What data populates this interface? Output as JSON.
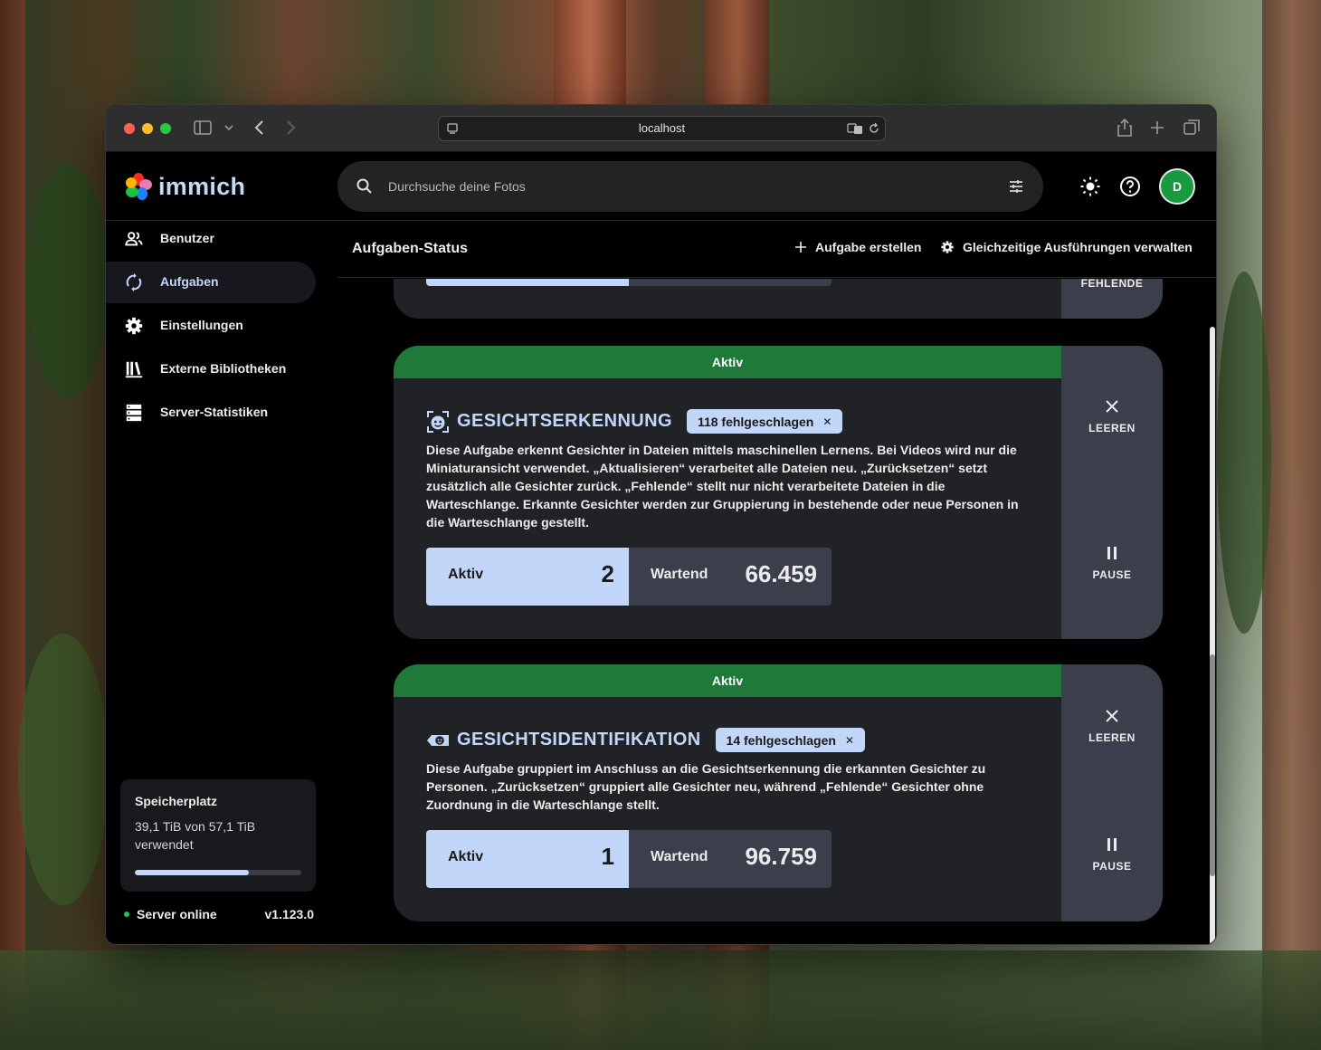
{
  "browser": {
    "url": "localhost"
  },
  "app": {
    "logo_text": "immich",
    "search_placeholder": "Durchsuche deine Fotos",
    "avatar_initial": "D"
  },
  "sidebar": {
    "items": [
      {
        "label": "Benutzer",
        "icon": "users-icon",
        "active": false
      },
      {
        "label": "Aufgaben",
        "icon": "sync-icon",
        "active": true
      },
      {
        "label": "Einstellungen",
        "icon": "gear-icon",
        "active": false
      },
      {
        "label": "Externe Bibliotheken",
        "icon": "library-icon",
        "active": false
      },
      {
        "label": "Server-Statistiken",
        "icon": "server-icon",
        "active": false
      }
    ],
    "storage": {
      "title": "Speicherplatz",
      "usage_text": "39,1 TiB von 57,1 TiB verwendet",
      "used_fraction": 0.685
    },
    "server_status": "Server online",
    "version": "v1.123.0"
  },
  "header": {
    "title": "Aufgaben-Status",
    "create_job": "Aufgabe erstellen",
    "manage_concurrency": "Gleichzeitige Ausführungen verwalten"
  },
  "previous_card": {
    "side_label": "FEHLENDE"
  },
  "jobs": [
    {
      "status": "Aktiv",
      "title": "GESICHTSERKENNUNG",
      "failed_badge": "118 fehlgeschlagen",
      "description": "Diese Aufgabe erkennt Gesichter in Dateien mittels maschinellen Lernens. Bei Videos wird nur die Miniaturansicht verwendet. „Aktualisieren“ verarbeitet alle Dateien neu. „Zurücksetzen“ setzt zusätzlich alle Gesichter zurück. „Fehlende“ stellt nur nicht verarbeitete Dateien in die Warteschlange. Erkannte Gesichter werden zur Gruppierung in bestehende oder neue Personen in die Warteschlange gestellt.",
      "active_label": "Aktiv",
      "active_count": "2",
      "waiting_label": "Wartend",
      "waiting_count": "66.459",
      "clear_label": "LEEREN",
      "pause_label": "PAUSE"
    },
    {
      "status": "Aktiv",
      "title": "GESICHTSIDENTIFIKATION",
      "failed_badge": "14 fehlgeschlagen",
      "description": "Diese Aufgabe gruppiert im Anschluss an die Gesichtserkennung die erkannten Gesichter zu Personen. „Zurücksetzen“ gruppiert alle Gesichter neu, während „Fehlende“ Gesichter ohne Zuordnung in die Warteschlange stellt.",
      "active_label": "Aktiv",
      "active_count": "1",
      "waiting_label": "Wartend",
      "waiting_count": "96.759",
      "clear_label": "LEEREN",
      "pause_label": "PAUSE"
    }
  ],
  "colors": {
    "accent": "#c2d6fa",
    "status_green": "#1f7a3a",
    "card_bg": "#212226",
    "side_bg": "#3b3f4c"
  }
}
